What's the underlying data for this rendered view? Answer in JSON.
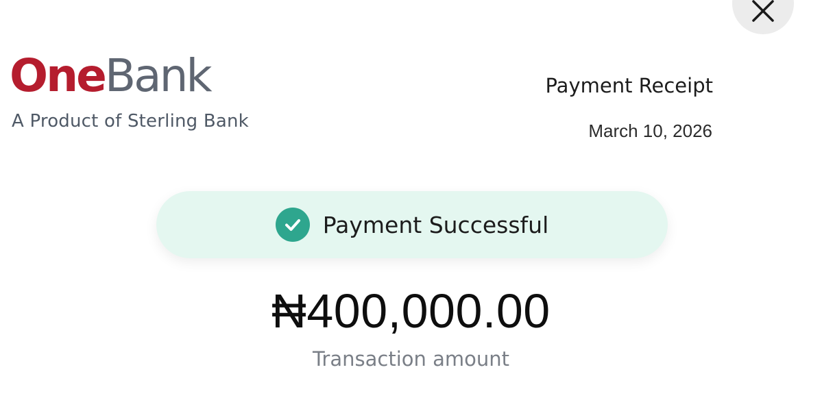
{
  "header": {
    "close_icon": "close-icon",
    "brand": {
      "logo_part1": "One",
      "logo_part2": "Bank",
      "tagline": "A Product of Sterling Bank"
    },
    "receipt_title": "Payment Receipt",
    "date": "March 10, 2026"
  },
  "status": {
    "icon": "check-circle-icon",
    "text": "Payment Successful"
  },
  "amount": {
    "value": "₦400,000.00",
    "label": "Transaction amount"
  },
  "colors": {
    "brand_red": "#b51d2e",
    "brand_gray": "#5f6672",
    "success_green": "#2ea68e",
    "success_background": "#e4f7f0"
  }
}
